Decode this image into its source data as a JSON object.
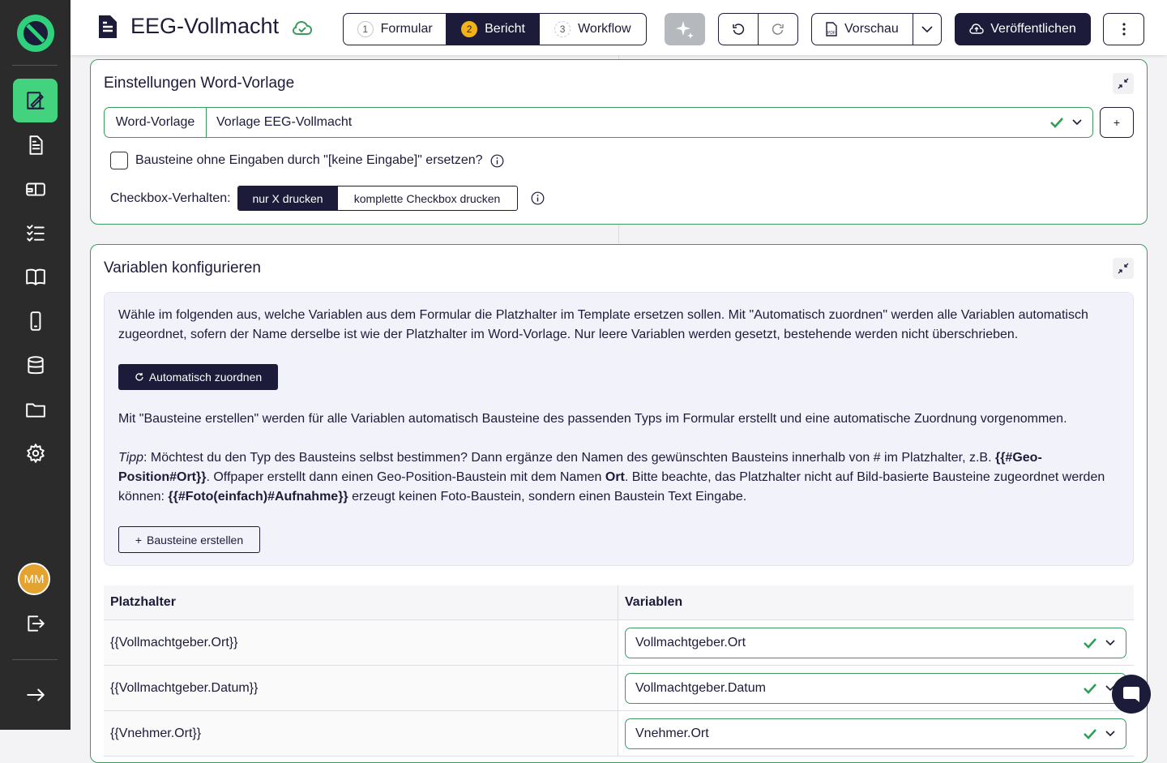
{
  "header": {
    "title": "EEG-Vollmacht",
    "steps": [
      {
        "num": "1",
        "label": "Formular"
      },
      {
        "num": "2",
        "label": "Bericht"
      },
      {
        "num": "3",
        "label": "Workflow"
      }
    ],
    "preview_label": "Vorschau",
    "publish_label": "Veröffentlichen"
  },
  "sidebar": {
    "avatar_initials": "MM"
  },
  "word_settings": {
    "title": "Einstellungen Word-Vorlage",
    "template_label": "Word-Vorlage",
    "template_value": "Vorlage EEG-Vollmacht",
    "add_label": "+",
    "replace_checkbox_label": "Bausteine ohne Eingaben durch \"[keine Eingabe]\" ersetzen?",
    "checkbox_behavior_label": "Checkbox-Verhalten:",
    "option_x": "nur X drucken",
    "option_full": "komplette Checkbox drucken"
  },
  "variables": {
    "title": "Variablen konfigurieren",
    "intro_text": "Wähle im folgenden aus, welche Variablen aus dem Formular die Platzhalter im Template ersetzen sollen. Mit \"Automatisch zuordnen\" werden alle Variablen automatisch zugeordnet, sofern der Name derselbe ist wie der Platzhalter im Word-Vorlage. Nur leere Variablen werden gesetzt, bestehende werden nicht überschrieben.",
    "auto_button": "Automatisch zuordnen",
    "create_text": "Mit \"Bausteine erstellen\" werden für alle Variablen automatisch Bausteine des passenden Typs im Formular erstellt und eine automatische Zuordnung vorgenommen.",
    "tip_label": "Tipp",
    "tip_1": ": Möchtest du den Typ des Bausteins selbst bestimmen? Dann ergänze den Namen des gewünschten Bausteins innerhalb von # im Platzhalter, z.B. ",
    "tip_code_1": "{{#Geo-Position#Ort}}",
    "tip_2": ". Offpaper erstellt dann einen Geo-Position-Baustein mit dem Namen ",
    "tip_name": "Ort",
    "tip_3": ". Bitte beachte, das Platzhalter nicht auf Bild-basierte Bausteine zugeordnet werden können: ",
    "tip_code_2": "{{#Foto(einfach)#Aufnahme}}",
    "tip_4": " erzeugt keinen Foto-Baustein, sondern einen Baustein Text Eingabe.",
    "create_button": "Bausteine erstellen",
    "col_placeholder": "Platzhalter",
    "col_variables": "Variablen",
    "rows": [
      {
        "placeholder": "{{Vollmachtgeber.Ort}}",
        "variable": "Vollmachtgeber.Ort"
      },
      {
        "placeholder": "{{Vollmachtgeber.Datum}}",
        "variable": "Vollmachtgeber.Datum"
      },
      {
        "placeholder": "{{Vnehmer.Ort}}",
        "variable": "Vnehmer.Ort"
      }
    ]
  },
  "colors": {
    "primary": "#1c1b3a",
    "accent_green": "#43d37f",
    "border_green": "#3c9a5f",
    "step_active_badge": "#f2b319",
    "sidebar_bg": "#2b2b2b"
  }
}
